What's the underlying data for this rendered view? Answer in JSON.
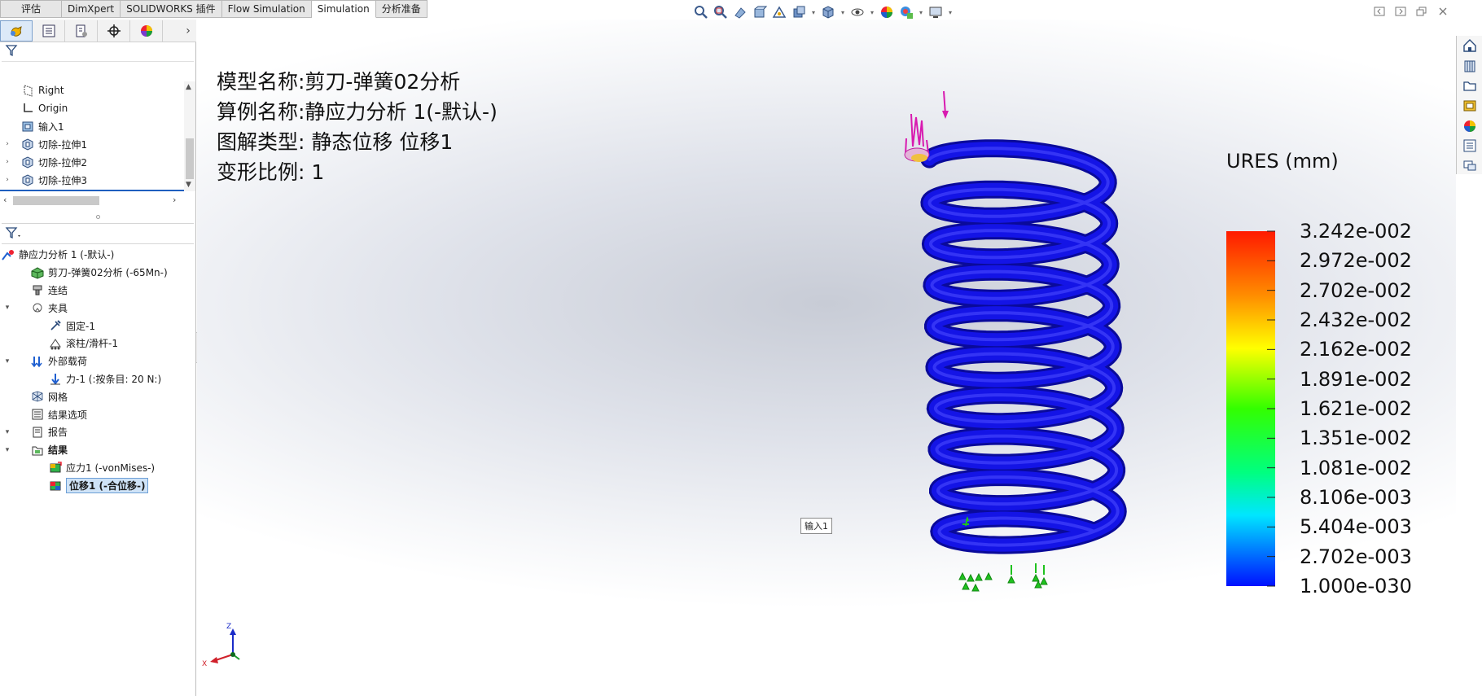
{
  "command_tabs": [
    {
      "label": "评估",
      "active": false
    },
    {
      "label": "DimXpert",
      "active": false
    },
    {
      "label": "SOLIDWORKS 插件",
      "active": false
    },
    {
      "label": "Flow Simulation",
      "active": false
    },
    {
      "label": "Simulation",
      "active": true
    },
    {
      "label": "分析准备",
      "active": false
    }
  ],
  "heads_up_icons": [
    "zoom-to-fit-icon",
    "zoom-to-area-icon",
    "previous-view-icon",
    "section-view-icon",
    "dynamic-annotation-icon",
    "view-orientation-icon",
    "display-style-icon",
    "hide-show-items-icon",
    "edit-appearance-icon",
    "apply-scene-icon",
    "view-settings-icon"
  ],
  "feature_tree": [
    {
      "label": "Right",
      "icon": "plane-icon",
      "expandable": false
    },
    {
      "label": "Origin",
      "icon": "origin-icon",
      "expandable": false
    },
    {
      "label": "输入1",
      "icon": "imported-body-icon",
      "expandable": false
    },
    {
      "label": "切除-拉伸1",
      "icon": "extrude-cut-icon",
      "expandable": true
    },
    {
      "label": "切除-拉伸2",
      "icon": "extrude-cut-icon",
      "expandable": true
    },
    {
      "label": "切除-拉伸3",
      "icon": "extrude-cut-icon",
      "expandable": true
    }
  ],
  "study_tree": [
    {
      "label": "静应力分析 1 (-默认-)",
      "indent": 0,
      "expandable": false,
      "icon": "static-study-icon"
    },
    {
      "label": "剪刀-弹簧02分析 (-65Mn-)",
      "indent": 1,
      "expandable": false,
      "icon": "part-material-icon"
    },
    {
      "label": "连结",
      "indent": 1,
      "expandable": false,
      "icon": "connections-icon"
    },
    {
      "label": "夹具",
      "indent": 1,
      "expandable": true,
      "icon": "fixtures-icon"
    },
    {
      "label": "固定-1",
      "indent": 2,
      "expandable": false,
      "icon": "fixed-geometry-icon"
    },
    {
      "label": "滚柱/滑杆-1",
      "indent": 2,
      "expandable": false,
      "icon": "roller-slider-icon"
    },
    {
      "label": "外部载荷",
      "indent": 1,
      "expandable": true,
      "icon": "external-loads-icon"
    },
    {
      "label": "力-1 (:按条目: 20 N:)",
      "indent": 2,
      "expandable": false,
      "icon": "force-icon"
    },
    {
      "label": "网格",
      "indent": 1,
      "expandable": false,
      "icon": "mesh-icon"
    },
    {
      "label": "结果选项",
      "indent": 1,
      "expandable": false,
      "icon": "result-options-icon"
    },
    {
      "label": "报告",
      "indent": 1,
      "expandable": true,
      "icon": "report-icon"
    },
    {
      "label": "结果",
      "indent": 1,
      "expandable": true,
      "icon": "results-folder-icon",
      "bold": true
    },
    {
      "label": "应力1 (-vonMises-)",
      "indent": 2,
      "expandable": false,
      "icon": "stress-plot-icon"
    },
    {
      "label": "位移1 (-合位移-)",
      "indent": 2,
      "expandable": false,
      "icon": "displacement-plot-icon",
      "selected": true
    }
  ],
  "plot_info": {
    "model_name": "模型名称:剪刀-弹簧02分析",
    "study_name": "算例名称:静应力分析 1(-默认-)",
    "plot_type": "图解类型: 静态位移 位移1",
    "deformation_scale": "变形比例: 1"
  },
  "legend": {
    "title": "URES (mm)",
    "ticks": [
      "3.242e-002",
      "2.972e-002",
      "2.702e-002",
      "2.432e-002",
      "2.162e-002",
      "1.891e-002",
      "1.621e-002",
      "1.351e-002",
      "1.081e-002",
      "8.106e-003",
      "5.404e-003",
      "2.702e-003",
      "1.000e-030"
    ]
  },
  "viewport_tag": "输入1",
  "triad": {
    "z": "Z",
    "x": "X"
  },
  "colors": {
    "spring": "#0b0bd6",
    "fixture": "#1fc21f",
    "load": "#e020c8"
  },
  "task_pane_icons": [
    "solidworks-resources-icon",
    "design-library-icon",
    "file-explorer-icon",
    "view-palette-icon",
    "appearances-scenes-icon",
    "custom-properties-icon",
    "forum-icon"
  ]
}
